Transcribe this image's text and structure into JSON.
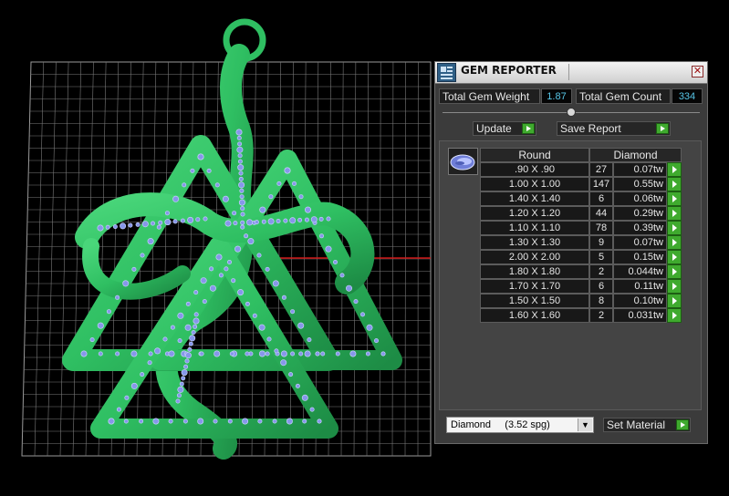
{
  "title": "GEM REPORTER",
  "close_label": "✕",
  "stats": {
    "weight_label": "Total Gem Weight",
    "weight_value": "1.87",
    "count_label": "Total Gem Count",
    "count_value": "334"
  },
  "buttons": {
    "update": "Update",
    "save_report": "Save Report",
    "set_material": "Set Material"
  },
  "table": {
    "header_shape": "Round",
    "header_material": "Diamond",
    "rows": [
      {
        "size": ".90 X .90",
        "count": "27",
        "weight": "0.07tw"
      },
      {
        "size": "1.00 X 1.00",
        "count": "147",
        "weight": "0.55tw"
      },
      {
        "size": "1.40 X 1.40",
        "count": "6",
        "weight": "0.06tw"
      },
      {
        "size": "1.20 X 1.20",
        "count": "44",
        "weight": "0.29tw"
      },
      {
        "size": "1.10 X 1.10",
        "count": "78",
        "weight": "0.39tw"
      },
      {
        "size": "1.30 X 1.30",
        "count": "9",
        "weight": "0.07tw"
      },
      {
        "size": "2.00 X 2.00",
        "count": "5",
        "weight": "0.15tw"
      },
      {
        "size": "1.80 X 1.80",
        "count": "2",
        "weight": "0.044tw"
      },
      {
        "size": "1.70 X 1.70",
        "count": "6",
        "weight": "0.11tw"
      },
      {
        "size": "1.50 X 1.50",
        "count": "8",
        "weight": "0.10tw"
      },
      {
        "size": "1.60 X 1.60",
        "count": "2",
        "weight": "0.031tw"
      }
    ]
  },
  "material": {
    "selected": "Diamond     (3.52 spg)"
  },
  "colors": {
    "model_green": "#2fbf62",
    "gem_blue": "#7f93e6",
    "grid_line": "#8a8a8a",
    "stat_value": "#57c5e6",
    "go_green": "#3faa2e"
  }
}
